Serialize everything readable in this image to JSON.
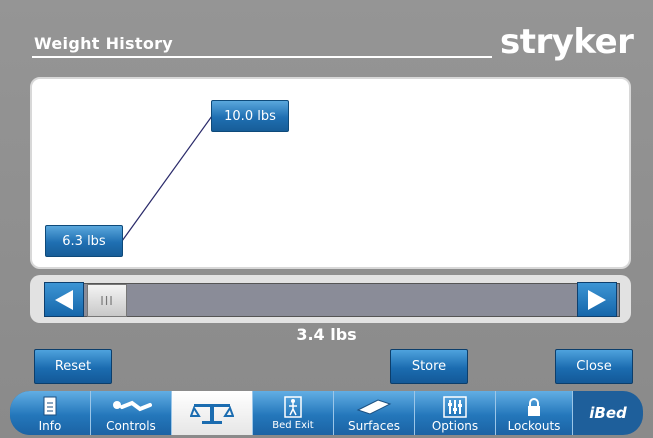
{
  "header": {
    "title": "Weight History",
    "logo": "stryker"
  },
  "chart_data": {
    "type": "line",
    "x": [
      1,
      2
    ],
    "values": [
      6.3,
      10.0
    ],
    "point_labels": [
      "6.3 lbs",
      "10.0 lbs"
    ]
  },
  "scroll": {
    "left_icon": "arrow-left-icon",
    "right_icon": "arrow-right-icon",
    "thumb_grip": "III"
  },
  "readout": {
    "value": "3.4 lbs"
  },
  "actions": {
    "reset": "Reset",
    "store": "Store",
    "close": "Close"
  },
  "tabs": [
    {
      "label": "Info",
      "icon": "info-icon"
    },
    {
      "label": "Controls",
      "icon": "patient-controls-icon"
    },
    {
      "label": "",
      "icon": "scale-icon",
      "active": true
    },
    {
      "label": "Bed Exit",
      "icon": "bed-exit-icon"
    },
    {
      "label": "Surfaces",
      "icon": "surface-icon"
    },
    {
      "label": "Options",
      "icon": "options-sliders-icon"
    },
    {
      "label": "Lockouts",
      "icon": "lock-icon"
    }
  ],
  "brand": "iBed",
  "colors": {
    "accent_blue": "#1f6fb2",
    "background_gray": "#8f8f8f",
    "panel_white": "#ffffff"
  }
}
